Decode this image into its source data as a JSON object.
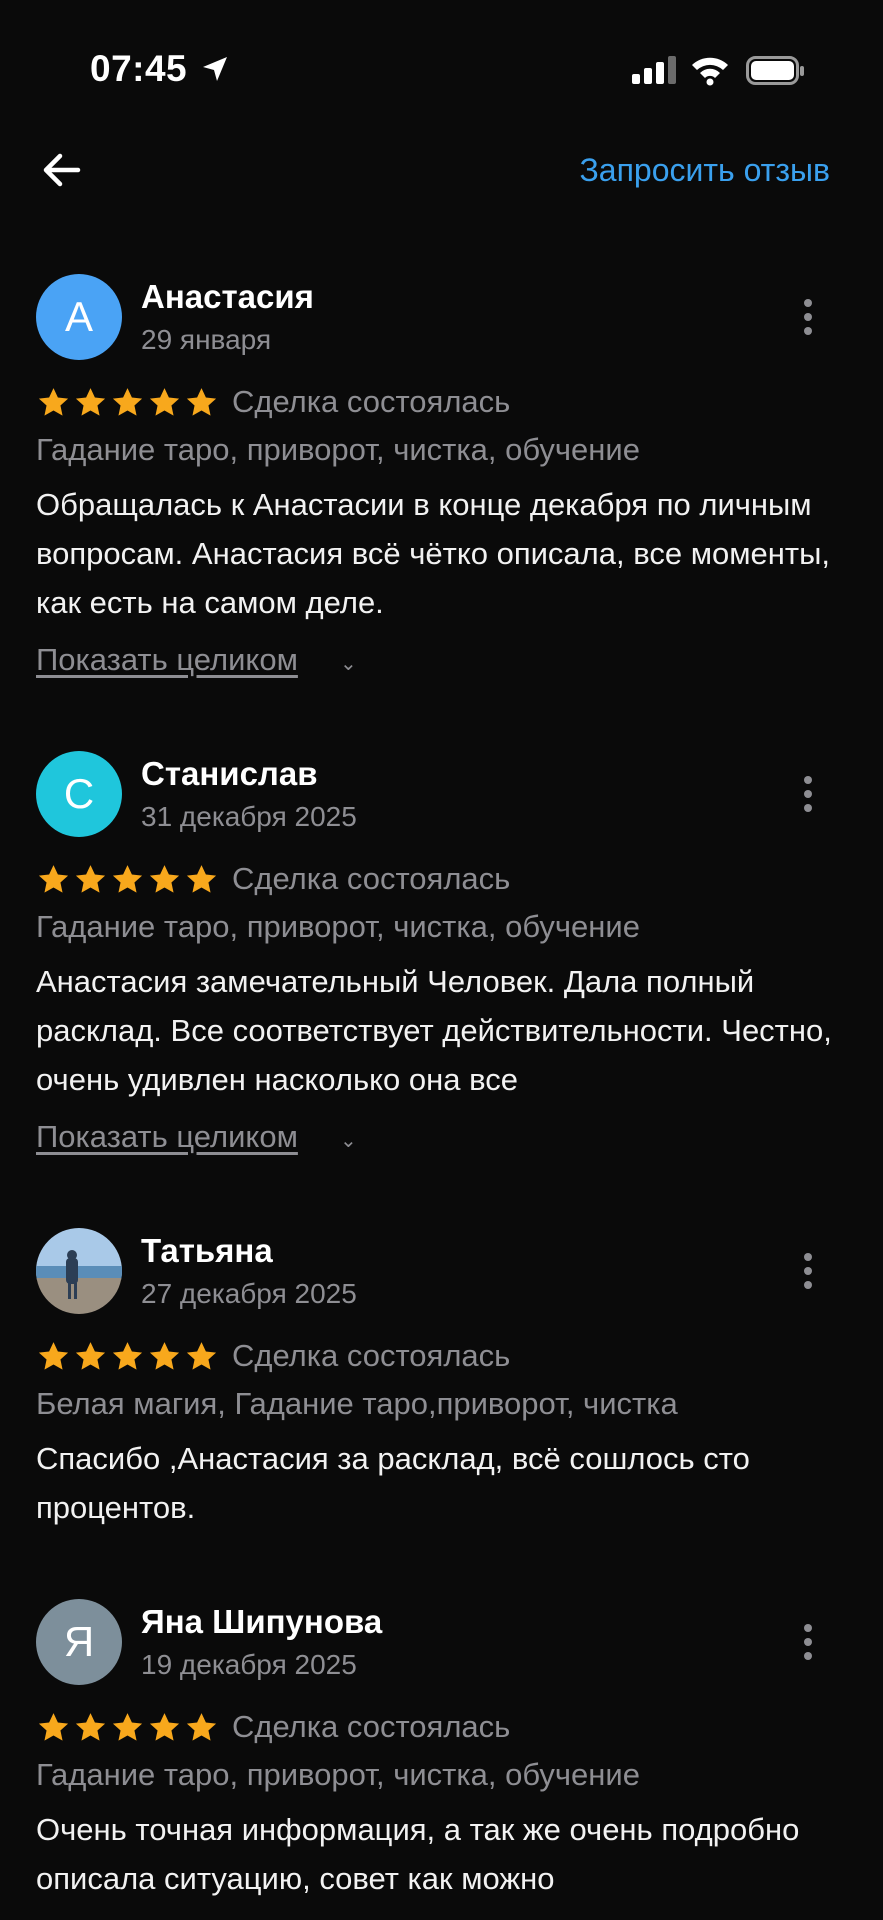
{
  "status_bar": {
    "time": "07:45"
  },
  "header": {
    "request_label": "Запросить отзыв"
  },
  "colors": {
    "accent": "#3aa0ee",
    "star": "#f8a81c",
    "muted": "#8e8e93"
  },
  "reviews": [
    {
      "initial": "А",
      "name": "Анастасия",
      "date": "29 января",
      "rating": 5,
      "deal": "Сделка состоялась",
      "category": "Гадание таро, приворот, чистка, обучение",
      "text": "Обращалась к Анастасии в конце декабря по личным вопросам. Анастасия всё чётко описала, все моменты, как есть на самом деле.",
      "show_full": "Показать целиком",
      "avatar_color": "#4aa3f5"
    },
    {
      "initial": "С",
      "name": "Станислав",
      "date": "31 декабря 2025",
      "rating": 5,
      "deal": "Сделка состоялась",
      "category": "Гадание таро, приворот, чистка, обучение",
      "text": "Анастасия замечательный Человек. Дала полный расклад. Все соответствует действительности. Честно, очень удивлен насколько она все",
      "show_full": "Показать целиком",
      "avatar_color": "#1fc6dc"
    },
    {
      "initial": "",
      "name": "Татьяна",
      "date": "27 декабря 2025",
      "rating": 5,
      "deal": "Сделка состоялась",
      "category": "Белая магия, Гадание таро,приворот, чистка",
      "text": "Спасибо ,Анастасия за расклад, всё сошлось сто процентов.",
      "avatar_color": "#8fb4d6"
    },
    {
      "initial": "Я",
      "name": "Яна Шипунова",
      "date": "19 декабря 2025",
      "rating": 5,
      "deal": "Сделка состоялась",
      "category": "Гадание таро, приворот, чистка, обучение",
      "text": "Очень точная информация, а так же очень подробно описала ситуацию, совет как можно",
      "avatar_color": "#7d8f9b"
    }
  ]
}
